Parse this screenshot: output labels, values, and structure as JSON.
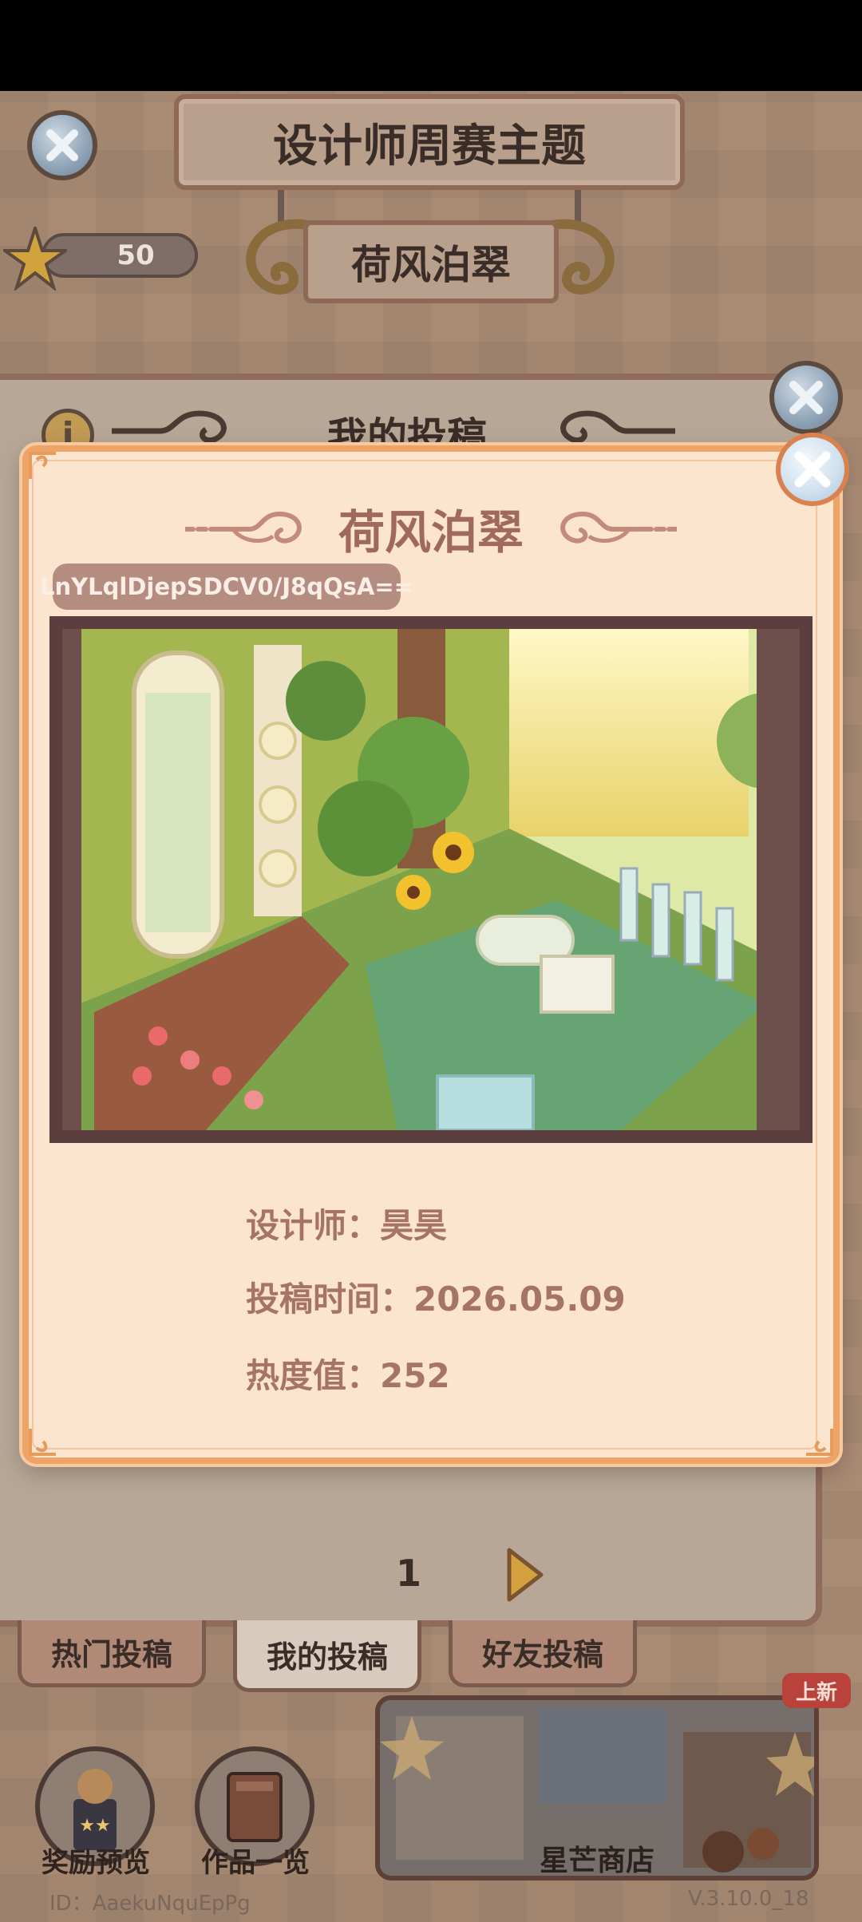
{
  "header": {
    "title": "设计师周赛主题",
    "theme": "荷风泊翠",
    "star_count": "50"
  },
  "panel": {
    "title": "我的投稿",
    "page": "1"
  },
  "tabs": [
    {
      "label": "热门投稿"
    },
    {
      "label": "我的投稿"
    },
    {
      "label": "好友投稿"
    }
  ],
  "bottom": {
    "reward_label": "奖励预览",
    "works_label": "作品一览",
    "shop_label": "星芒商店",
    "new_badge": "上新",
    "user_id": "ID：AaekuNquEpPg",
    "version": "V.3.10.0_18"
  },
  "modal": {
    "title": "荷风泊翠",
    "code": "LnYLqlDjepSDCV0/J8qQsA==",
    "designer_label": "设计师：",
    "designer": "昊昊",
    "time_label": "投稿时间：",
    "time": "2026.05.09",
    "heat_label": "热度值：",
    "heat": "252"
  },
  "colors": {
    "modal_bg": "#fbe5cf",
    "modal_border": "#eea467",
    "text_accent": "#a57467",
    "frame": "#5c3e3f"
  }
}
